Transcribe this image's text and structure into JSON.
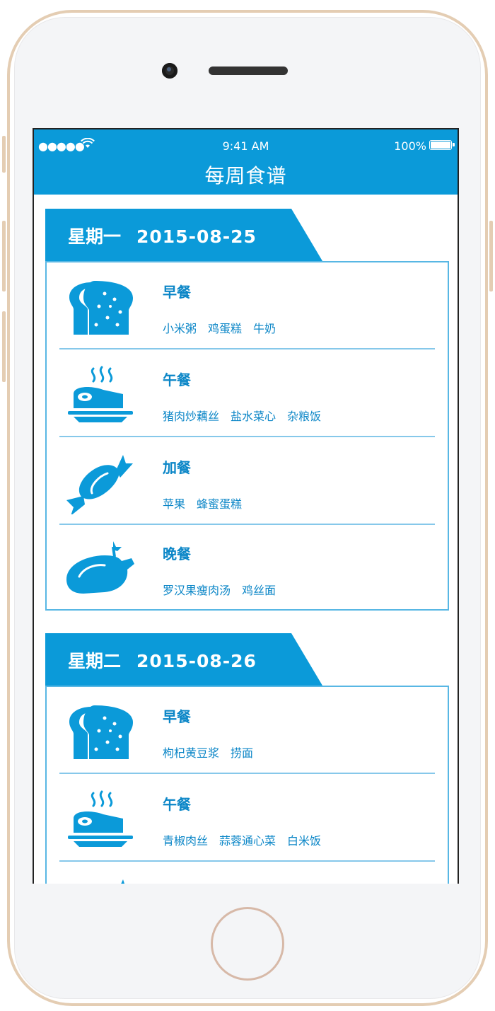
{
  "status_bar": {
    "signal": "●●●●●",
    "time": "9:41 AM",
    "battery": "100%"
  },
  "navbar": {
    "title": "每周食谱"
  },
  "days": [
    {
      "day": "星期一",
      "date": "2015-08-25",
      "meals": [
        {
          "name": "早餐",
          "icon": "bread-icon",
          "items": [
            "小米粥",
            "鸡蛋糕",
            "牛奶"
          ]
        },
        {
          "name": "午餐",
          "icon": "hot-meal-icon",
          "items": [
            "猪肉炒藕丝",
            "盐水菜心",
            "杂粮饭"
          ]
        },
        {
          "name": "加餐",
          "icon": "candy-icon",
          "items": [
            "苹果",
            "蜂蜜蛋糕"
          ]
        },
        {
          "name": "晚餐",
          "icon": "roast-chicken-icon",
          "items": [
            "罗汉果瘦肉汤",
            "鸡丝面"
          ]
        }
      ]
    },
    {
      "day": "星期二",
      "date": "2015-08-26",
      "meals": [
        {
          "name": "早餐",
          "icon": "bread-icon",
          "items": [
            "枸杞黄豆浆",
            "捞面"
          ]
        },
        {
          "name": "午餐",
          "icon": "hot-meal-icon",
          "items": [
            "青椒肉丝",
            "蒜蓉通心菜",
            "白米饭"
          ]
        }
      ]
    }
  ],
  "colors": {
    "accent": "#0b9ad9",
    "text": "#0b86c7",
    "border": "#58b7e4"
  }
}
